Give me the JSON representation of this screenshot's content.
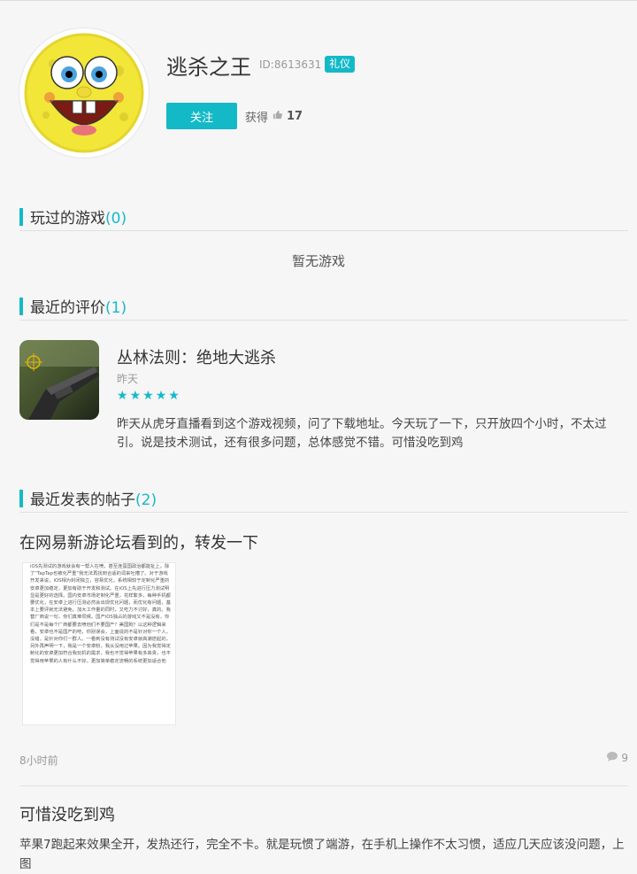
{
  "profile": {
    "username": "逃杀之王",
    "user_id": "ID:8613631",
    "badge": "礼仪",
    "follow_label": "关注",
    "likes_label": "获得",
    "likes_count": "17"
  },
  "sections": {
    "played": {
      "title": "玩过的游戏",
      "count": "(0)",
      "empty": "暂无游戏"
    },
    "reviews": {
      "title": "最近的评价",
      "count": "(1)"
    },
    "posts": {
      "title": "最近发表的帖子",
      "count": "(2)"
    }
  },
  "review": {
    "game_title": "丛林法则：绝地大逃杀",
    "date": "昨天",
    "rating": 5,
    "body": "昨天从虎牙直播看到这个游戏视频，问了下载地址。今天玩了一下，只开放四个小时，不太过引。说是技术测试，还有很多问题，总体感觉不错。可惜没吃到鸡"
  },
  "posts": [
    {
      "title": "在网易新游论坛看到的，转发一下",
      "image_text": "iOS先测试的游戏就会有一帮人在喷，甚至连蛋国政治都能扯上。除了“TapTap也被化严重”我无法再找到合适的词来吐槽了。对于游戏开发来说，iOS相为封闭独立，容易优化，系统相较于定制化严重的安卓更加稳定，更加有助于开发和测试。在iOS上先进行压力测试明显是更好的选择。国内安卓市场定制化严重，花样繁多，每种手机都要优化，在安卓上进行压测必然会出现优化问题，而优化有问题，基本上要评就无法避免。加大工作量的同时，又吃力不讨好，真的。我替厂商说一句，你们真难伺候。国产iOS独占的游戏又不是没有，你们是不是每个厂商都要去喷他们不要国产？美国狗？以这种逻辑来看，安卓也不是国产的吧，你别误会，上面说的不是针对你一个人，没错，是针对你们一群人。一看到没有测试没有安卓就高潮迭起的，另外再声明一下，我是一个安卓粉，我从没用过苹果。因为我觉得定制化的安卓更加符合我玩机的需求，我也不觉得苹果有多高贵，也不觉得用苹果的人有什么不好。更加简单稳定流畅的系统更加适合他",
      "time": "8小时前",
      "comments": "9"
    },
    {
      "title": "可惜没吃到鸡",
      "body": "苹果7跑起来效果全开，发热还行，完全不卡。就是玩惯了端游，在手机上操作不太习惯，适应几天应该没问题，上图"
    }
  ],
  "colors": {
    "accent": "#14b9c8"
  }
}
